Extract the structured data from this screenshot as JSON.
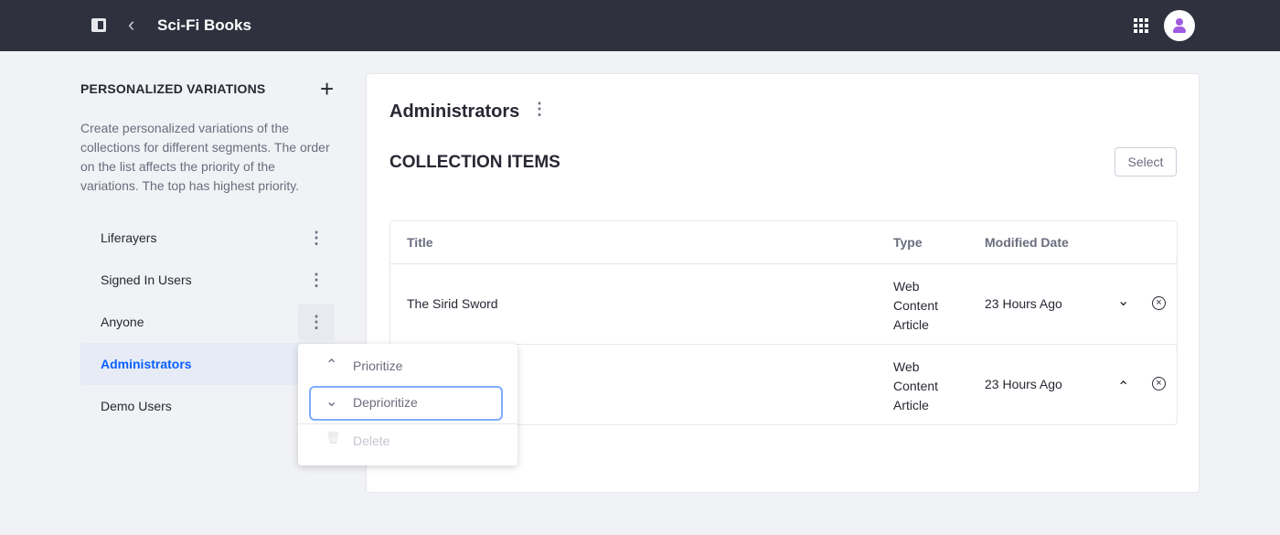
{
  "header": {
    "title": "Sci-Fi Books",
    "back_icon": "chevron-left-icon",
    "panel_icon": "sidebar-toggle-icon",
    "apps_icon": "apps-grid-icon",
    "avatar_icon": "user-icon"
  },
  "sidebar": {
    "heading": "PERSONALIZED VARIATIONS",
    "add_label": "+",
    "description": "Create personalized variations of the collections for different segments. The order on the list affects the priority of the variations. The top has highest priority.",
    "items": [
      {
        "label": "Liferayers"
      },
      {
        "label": "Signed In Users"
      },
      {
        "label": "Anyone"
      },
      {
        "label": "Administrators",
        "active": true
      },
      {
        "label": "Demo Users"
      }
    ],
    "kebab": "⋮"
  },
  "main": {
    "title": "Administrators",
    "kebab": "⋮",
    "section": "COLLECTION ITEMS",
    "select_label": "Select",
    "columns": [
      "Title",
      "Type",
      "Modified Date"
    ],
    "rows": [
      {
        "title": "The Sirid Sword",
        "type": "Web Content Article",
        "date": "23 Hours Ago",
        "move": "⌄"
      },
      {
        "title": "",
        "type": "Web Content Article",
        "date": "23 Hours Ago",
        "move": "⌃"
      }
    ],
    "remove": "×"
  },
  "menu": {
    "items": [
      {
        "label": "Prioritize",
        "icon": "⌃"
      },
      {
        "label": "Deprioritize",
        "icon": "⌄"
      },
      {
        "label": "Delete",
        "icon": "🗑",
        "disabled": true
      }
    ]
  },
  "colors": {
    "topbar": "#30313f",
    "accent": "#0b5fff",
    "focus": "#80acff"
  }
}
